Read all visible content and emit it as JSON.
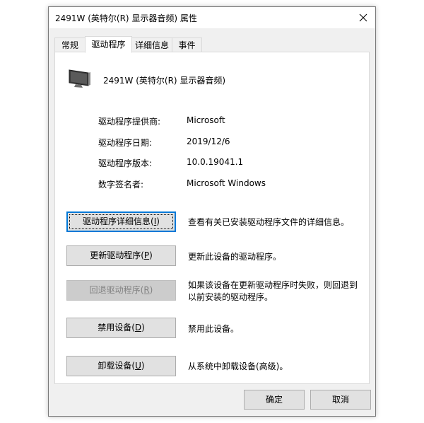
{
  "window": {
    "title": "2491W (英特尔(R) 显示器音频) 属性"
  },
  "tabs": [
    {
      "label": "常规",
      "active": false
    },
    {
      "label": "驱动程序",
      "active": true
    },
    {
      "label": "详细信息",
      "active": false
    },
    {
      "label": "事件",
      "active": false
    }
  ],
  "device": {
    "icon": "monitor-icon",
    "name": "2491W (英特尔(R) 显示器音频)"
  },
  "info": [
    {
      "label": "驱动程序提供商:",
      "value": "Microsoft"
    },
    {
      "label": "驱动程序日期:",
      "value": "2019/12/6"
    },
    {
      "label": "驱动程序版本:",
      "value": "10.0.19041.1"
    },
    {
      "label": "数字签名者:",
      "value": "Microsoft Windows"
    }
  ],
  "actions": [
    {
      "button": "驱动程序详细信息(",
      "key": "I",
      "description": "查看有关已安装驱动程序文件的详细信息。",
      "enabled": true,
      "focused": true
    },
    {
      "button": "更新驱动程序(",
      "key": "P",
      "description": "更新此设备的驱动程序。",
      "enabled": true,
      "focused": false
    },
    {
      "button": "回退驱动程序(",
      "key": "R",
      "description": "如果该设备在更新驱动程序时失败，则回退到以前安装的驱动程序。",
      "enabled": false,
      "focused": false
    },
    {
      "button": "禁用设备(",
      "key": "D",
      "description": "禁用此设备。",
      "enabled": true,
      "focused": false
    },
    {
      "button": "卸载设备(",
      "key": "U",
      "description": "从系统中卸载设备(高级)。",
      "enabled": true,
      "focused": false
    }
  ],
  "footer": {
    "ok_label": "确定",
    "cancel_label": "取消"
  },
  "colors": {
    "focus_border": "#0078d7",
    "button_face": "#e1e1e1",
    "disabled_face": "#cccccc",
    "disabled_text": "#838383"
  }
}
